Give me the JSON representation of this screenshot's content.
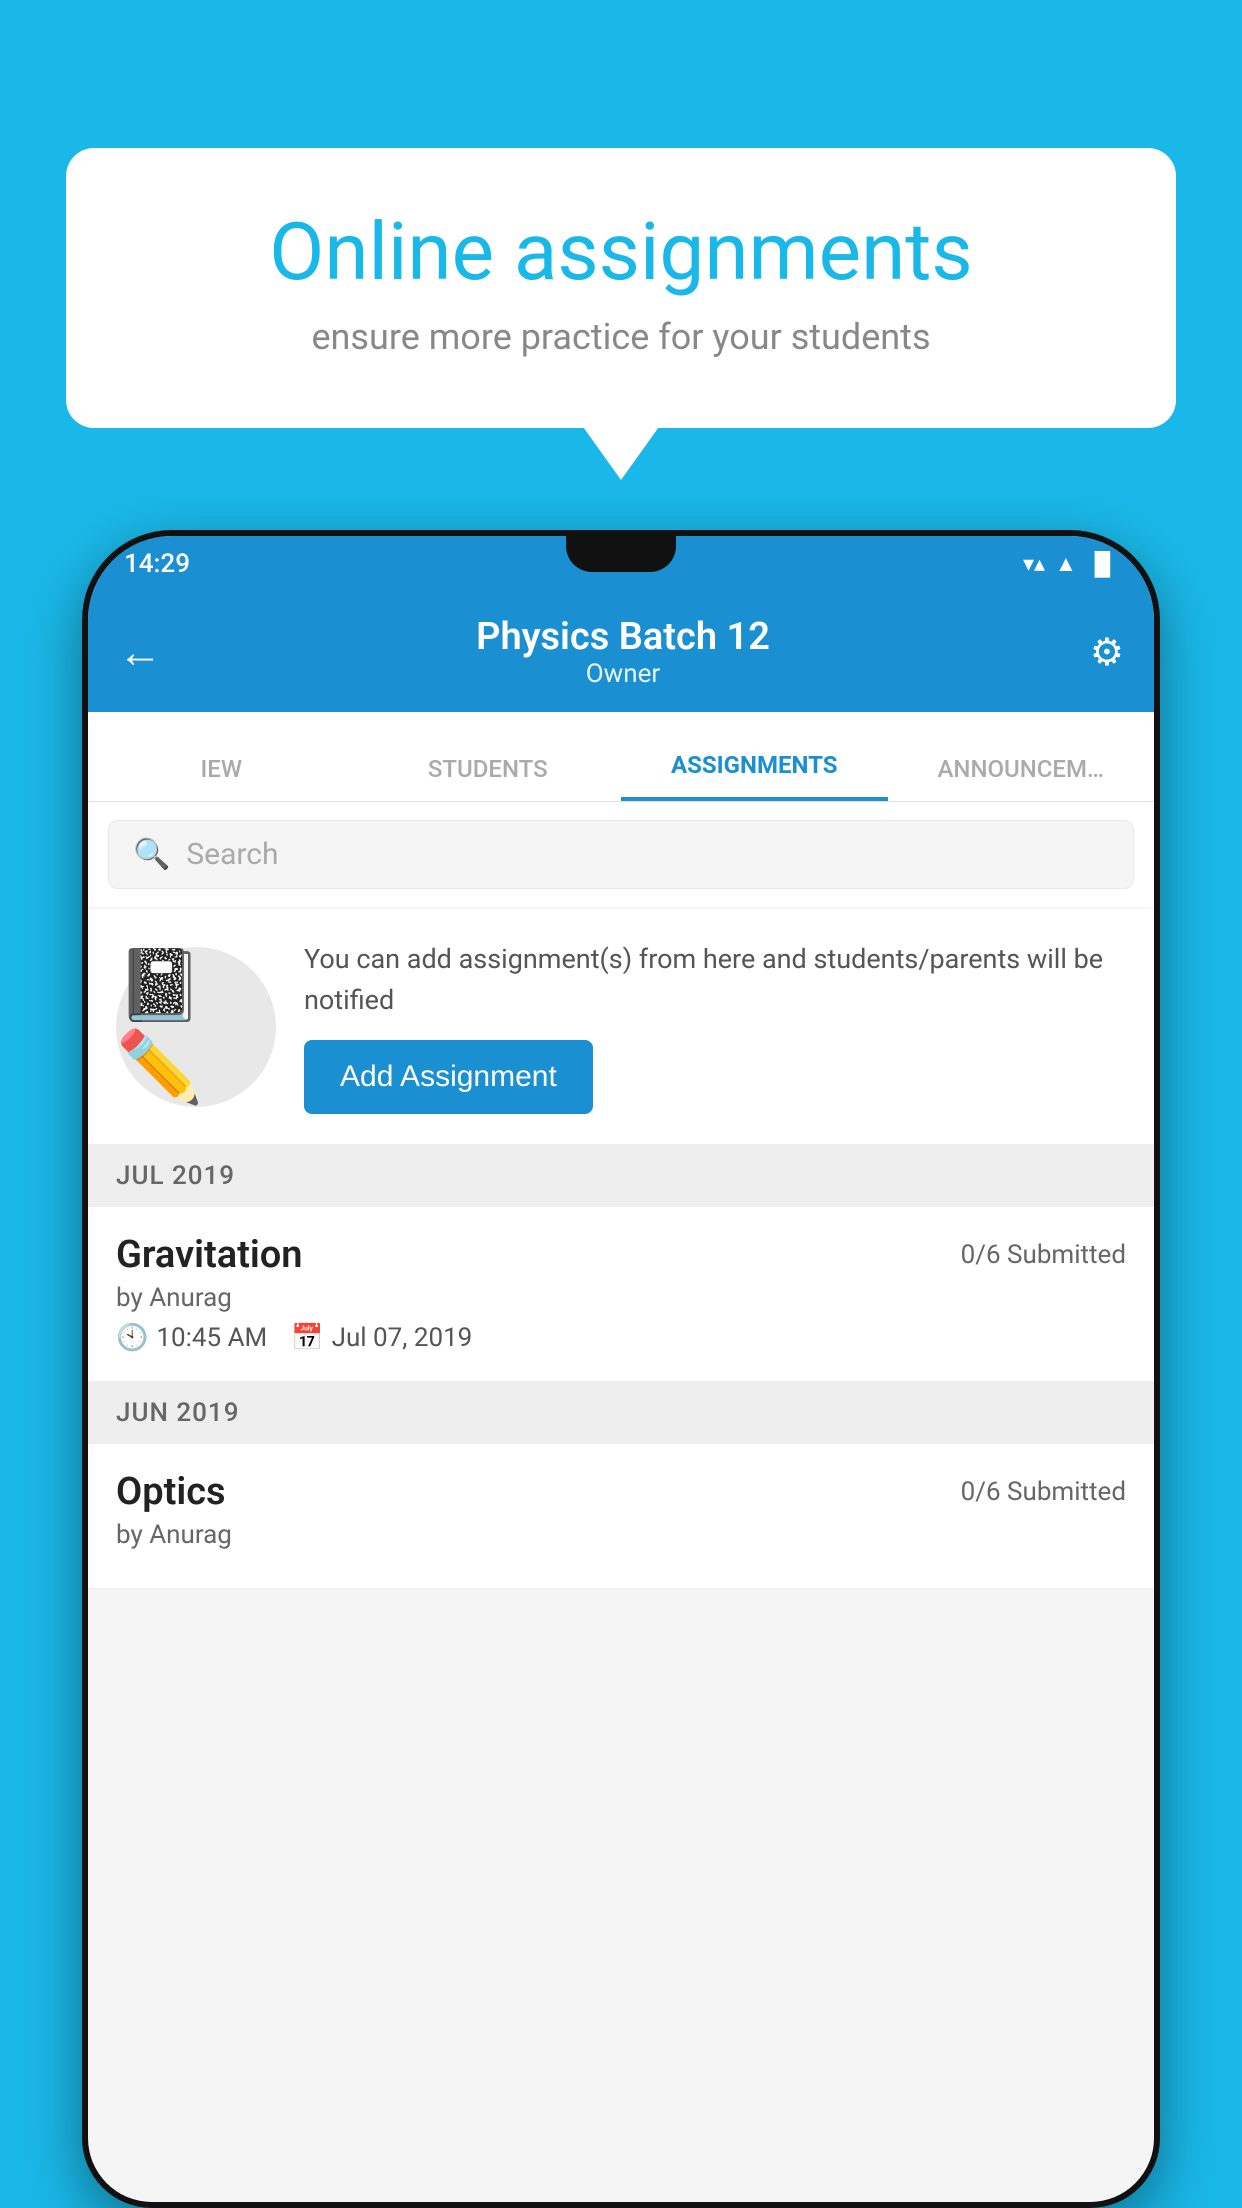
{
  "background_color": "#1ab8e8",
  "speech_bubble": {
    "title": "Online assignments",
    "subtitle": "ensure more practice for your students"
  },
  "status_bar": {
    "time": "14:29",
    "wifi": "▼",
    "signal": "▲",
    "battery": "▐"
  },
  "app_bar": {
    "title": "Physics Batch 12",
    "subtitle": "Owner",
    "back_label": "←",
    "settings_label": "⚙"
  },
  "tabs": [
    {
      "label": "IEW",
      "active": false
    },
    {
      "label": "STUDENTS",
      "active": false
    },
    {
      "label": "ASSIGNMENTS",
      "active": true
    },
    {
      "label": "ANNOUNCEM…",
      "active": false
    }
  ],
  "search": {
    "placeholder": "Search"
  },
  "promo": {
    "text": "You can add assignment(s) from here and students/parents will be notified",
    "button_label": "Add Assignment"
  },
  "sections": [
    {
      "header": "JUL 2019",
      "assignments": [
        {
          "name": "Gravitation",
          "submitted": "0/6 Submitted",
          "author": "by Anurag",
          "time": "10:45 AM",
          "date": "Jul 07, 2019"
        }
      ]
    },
    {
      "header": "JUN 2019",
      "assignments": [
        {
          "name": "Optics",
          "submitted": "0/6 Submitted",
          "author": "by Anurag",
          "time": "",
          "date": ""
        }
      ]
    }
  ]
}
